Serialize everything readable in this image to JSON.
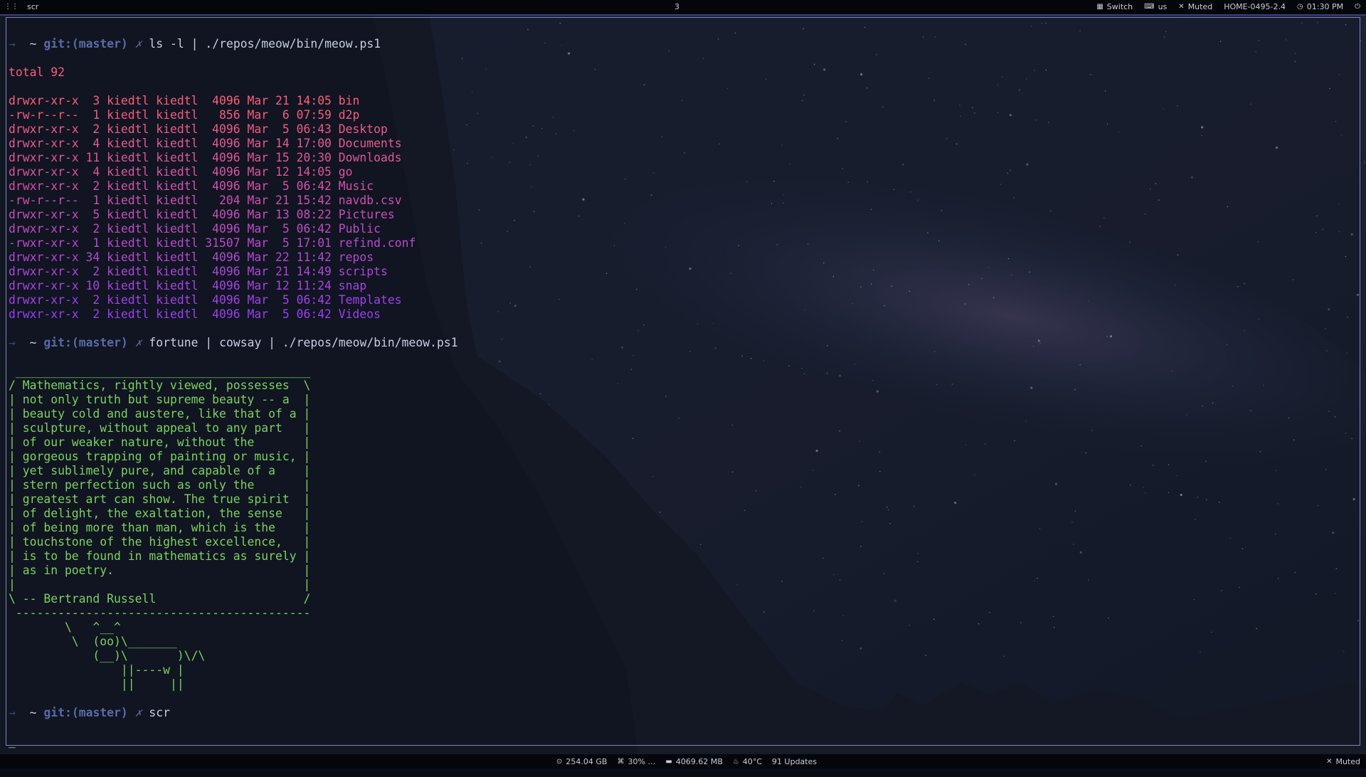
{
  "colors": {
    "accent": "#7d86b8",
    "top_border": "#3a3f78",
    "prompt": "#5b6aa8",
    "cowsay_text": "#7cd25e",
    "listing_gradient_start": "#ff5c7a",
    "listing_gradient_end": "#9a3ff2"
  },
  "topbar": {
    "app_name": "scr",
    "workspace": "3",
    "switch_label": "Switch",
    "keyboard_layout": "us",
    "volume_label": "Muted",
    "hostname": "HOME-0495-2.4",
    "clock": "01:30 PM",
    "icons": [
      "grid-icon",
      "switch-icon",
      "keyboard-icon",
      "volume-muted-icon",
      "clock-icon",
      "power-icon"
    ]
  },
  "terminal": {
    "prompts": [
      {
        "arrow": "→",
        "dir": "~",
        "git": "git:(master)",
        "dirty": "✗",
        "command": "ls -l | ./repos/meow/bin/meow.ps1"
      },
      {
        "arrow": "→",
        "dir": "~",
        "git": "git:(master)",
        "dirty": "✗",
        "command": "fortune | cowsay | ./repos/meow/bin/meow.ps1"
      },
      {
        "arrow": "→",
        "dir": "~",
        "git": "git:(master)",
        "dirty": "✗",
        "command": "scr"
      }
    ],
    "total_line": "total 92",
    "listing": [
      "drwxr-xr-x  3 kiedtl kiedtl  4096 Mar 21 14:05 bin",
      "-rw-r--r--  1 kiedtl kiedtl   856 Mar  6 07:59 d2p",
      "drwxr-xr-x  2 kiedtl kiedtl  4096 Mar  5 06:43 Desktop",
      "drwxr-xr-x  4 kiedtl kiedtl  4096 Mar 14 17:00 Documents",
      "drwxr-xr-x 11 kiedtl kiedtl  4096 Mar 15 20:30 Downloads",
      "drwxr-xr-x  4 kiedtl kiedtl  4096 Mar 12 14:05 go",
      "drwxr-xr-x  2 kiedtl kiedtl  4096 Mar  5 06:42 Music",
      "-rw-r--r--  1 kiedtl kiedtl   204 Mar 21 15:42 navdb.csv",
      "drwxr-xr-x  5 kiedtl kiedtl  4096 Mar 13 08:22 Pictures",
      "drwxr-xr-x  2 kiedtl kiedtl  4096 Mar  5 06:42 Public",
      "-rwxr-xr-x  1 kiedtl kiedtl 31507 Mar  5 17:01 refind.conf",
      "drwxr-xr-x 34 kiedtl kiedtl  4096 Mar 22 11:42 repos",
      "drwxr-xr-x  2 kiedtl kiedtl  4096 Mar 21 14:49 scripts",
      "drwxr-xr-x 10 kiedtl kiedtl  4096 Mar 12 11:24 snap",
      "drwxr-xr-x  2 kiedtl kiedtl  4096 Mar  5 06:42 Templates",
      "drwxr-xr-x  2 kiedtl kiedtl  4096 Mar  5 06:42 Videos"
    ],
    "cowsay": [
      " __________________________________________",
      "/ Mathematics, rightly viewed, possesses  \\",
      "| not only truth but supreme beauty -- a  |",
      "| beauty cold and austere, like that of a |",
      "| sculpture, without appeal to any part   |",
      "| of our weaker nature, without the       |",
      "| gorgeous trapping of painting or music, |",
      "| yet sublimely pure, and capable of a    |",
      "| stern perfection such as only the       |",
      "| greatest art can show. The true spirit  |",
      "| of delight, the exaltation, the sense   |",
      "| of being more than man, which is the    |",
      "| touchstone of the highest excellence,   |",
      "| is to be found in mathematics as surely |",
      "| as in poetry.                           |",
      "|                                         |",
      "\\ -- Bertrand Russell                     /",
      " ------------------------------------------",
      "        \\   ^__^",
      "         \\  (oo)\\_______",
      "            (__)\\       )\\/\\",
      "                ||----w |",
      "                ||     ||"
    ],
    "cursor": "_"
  },
  "bottombar": {
    "disk": "254.04 GB",
    "cpu": "30% …",
    "memory": "4069.62 MB",
    "temperature": "40°C",
    "updates": "91 Updates",
    "volume_label": "Muted",
    "icons": [
      "disk-icon",
      "cpu-icon",
      "memory-icon",
      "temperature-icon",
      "volume-muted-icon"
    ]
  }
}
